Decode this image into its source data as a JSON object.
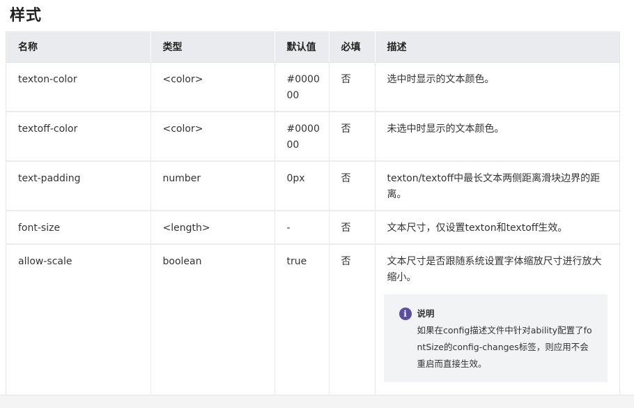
{
  "section": {
    "title": "样式"
  },
  "table": {
    "headers": [
      "名称",
      "类型",
      "默认值",
      "必填",
      "描述"
    ],
    "rows": [
      {
        "name": "texton-color",
        "type": "<color>",
        "default": "#000000",
        "required": "否",
        "desc": "选中时显示的文本颜色。"
      },
      {
        "name": "textoff-color",
        "type": "<color>",
        "default": "#000000",
        "required": "否",
        "desc": "未选中时显示的文本颜色。"
      },
      {
        "name": "text-padding",
        "type": "number",
        "default": "0px",
        "required": "否",
        "desc": "texton/textoff中最长文本两侧距离滑块边界的距离。"
      },
      {
        "name": "font-size",
        "type": "<length>",
        "default": "-",
        "required": "否",
        "desc": "文本尺寸，仅设置texton和textoff生效。"
      },
      {
        "name": "allow-scale",
        "type": "boolean",
        "default": "true",
        "required": "否",
        "desc": "文本尺寸是否跟随系统设置字体缩放尺寸进行放大缩小。",
        "note": {
          "icon": "info-icon",
          "title": "说明",
          "body": "如果在config描述文件中针对ability配置了fontSize的config-changes标签，则应用不会重启而直接生效。"
        }
      }
    ]
  },
  "colors": {
    "header_bg": "#e9ebee",
    "note_bg": "#f1f3f5",
    "info_icon": "#5b4ea1"
  }
}
